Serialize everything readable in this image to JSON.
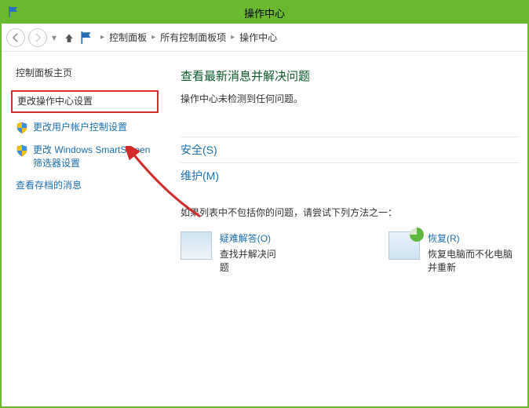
{
  "window": {
    "title": "操作中心"
  },
  "breadcrumb": {
    "items": [
      "控制面板",
      "所有控制面板项",
      "操作中心"
    ]
  },
  "sidebar": {
    "heading": "控制面板主页",
    "items": [
      {
        "label": "更改操作中心设置",
        "highlighted": true
      },
      {
        "label": "更改用户帐户控制设置"
      },
      {
        "label": "更改 Windows SmartScreen 筛选器设置"
      },
      {
        "label": "查看存档的消息"
      }
    ]
  },
  "main": {
    "heading": "查看最新消息并解决问题",
    "subtext": "操作中心未检测到任何问题。",
    "sections": [
      {
        "label": "安全(S)"
      },
      {
        "label": "维护(M)"
      }
    ],
    "fallback_text": "如果列表中不包括你的问题，请尝试下列方法之一：",
    "tools": [
      {
        "title": "疑难解答(O)",
        "desc": "查找并解决问题"
      },
      {
        "title": "恢复(R)",
        "desc": "恢复电脑而不化电脑并重新"
      }
    ]
  }
}
